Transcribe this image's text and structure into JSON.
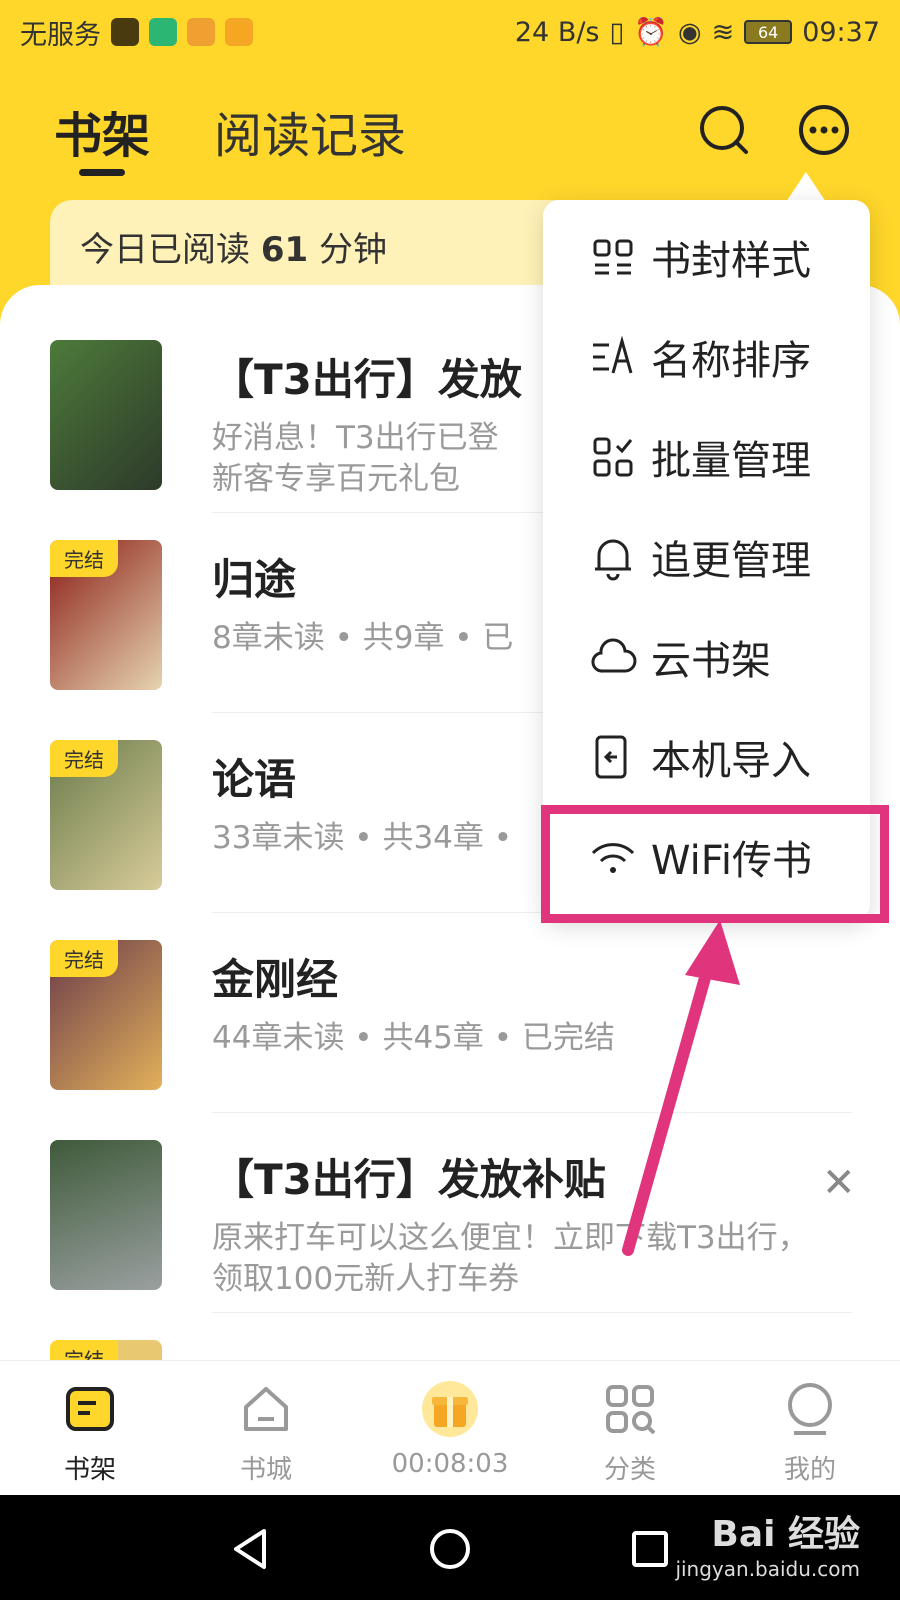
{
  "status_bar": {
    "carrier": "无服务",
    "net_speed": "24 B/s",
    "battery": "64",
    "time": "09:37"
  },
  "header": {
    "tab_shelf": "书架",
    "tab_history": "阅读记录"
  },
  "reading": {
    "prefix": "今日已阅读",
    "minutes": "61",
    "suffix": "分钟"
  },
  "books": [
    {
      "title": "【T3出行】发放",
      "subtitle": "好消息！T3出行已登\n新客专享百元礼包",
      "badge": ""
    },
    {
      "title": "归途",
      "subtitle": "8章未读 • 共9章 • 已",
      "badge": "完结"
    },
    {
      "title": "论语",
      "subtitle": "33章未读 • 共34章 •",
      "badge": "完结"
    },
    {
      "title": "金刚经",
      "subtitle": "44章未读 • 共45章 • 已完结",
      "badge": "完结"
    },
    {
      "title": "【T3出行】发放补贴",
      "subtitle": "原来打车可以这么便宜！立即下载T3出行，领取100元新人打车券",
      "badge": ""
    },
    {
      "title": "",
      "subtitle": "",
      "badge": "完结"
    }
  ],
  "menu": [
    {
      "label": "书封样式",
      "icon": "cover-style-icon"
    },
    {
      "label": "名称排序",
      "icon": "sort-name-icon"
    },
    {
      "label": "批量管理",
      "icon": "batch-manage-icon"
    },
    {
      "label": "追更管理",
      "icon": "bell-icon"
    },
    {
      "label": "云书架",
      "icon": "cloud-icon"
    },
    {
      "label": "本机导入",
      "icon": "import-icon"
    },
    {
      "label": "WiFi传书",
      "icon": "wifi-icon"
    }
  ],
  "bottom_nav": {
    "shelf": "书架",
    "store": "书城",
    "timer": "00:08:03",
    "category": "分类",
    "mine": "我的"
  },
  "watermark": {
    "logo": "Bai 经验",
    "url": "jingyan.baidu.com"
  },
  "colors": {
    "brand_yellow": "#ffd62a",
    "highlight_pink": "#e0347d"
  }
}
